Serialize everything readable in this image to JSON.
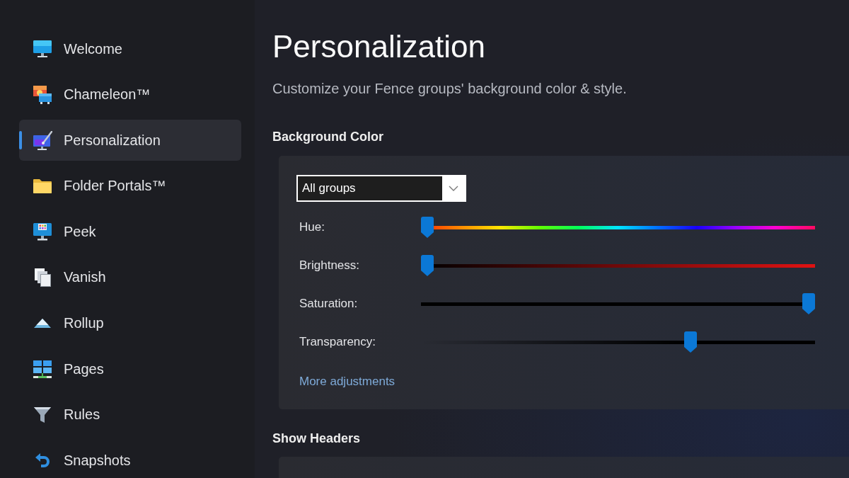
{
  "sidebar": {
    "items": [
      {
        "label": "Welcome",
        "selected": false
      },
      {
        "label": "Chameleon™",
        "selected": false
      },
      {
        "label": "Personalization",
        "selected": true
      },
      {
        "label": "Folder Portals™",
        "selected": false
      },
      {
        "label": "Peek",
        "selected": false
      },
      {
        "label": "Vanish",
        "selected": false
      },
      {
        "label": "Rollup",
        "selected": false
      },
      {
        "label": "Pages",
        "selected": false
      },
      {
        "label": "Rules",
        "selected": false
      },
      {
        "label": "Snapshots",
        "selected": false
      }
    ]
  },
  "page": {
    "title": "Personalization",
    "subtitle": "Customize your Fence groups' background color & style."
  },
  "background_color": {
    "heading": "Background Color",
    "dropdown": {
      "value": "All groups"
    },
    "sliders": [
      {
        "kind": "hue",
        "label": "Hue:",
        "level": 0
      },
      {
        "kind": "brightness",
        "label": "Brightness:",
        "level": 0
      },
      {
        "kind": "saturation",
        "label": "Saturation:",
        "level": 1
      },
      {
        "kind": "transparency",
        "label": "Transparency:",
        "level": 0.69
      }
    ],
    "link": "More adjustments"
  },
  "show_headers": {
    "heading": "Show Headers"
  }
}
